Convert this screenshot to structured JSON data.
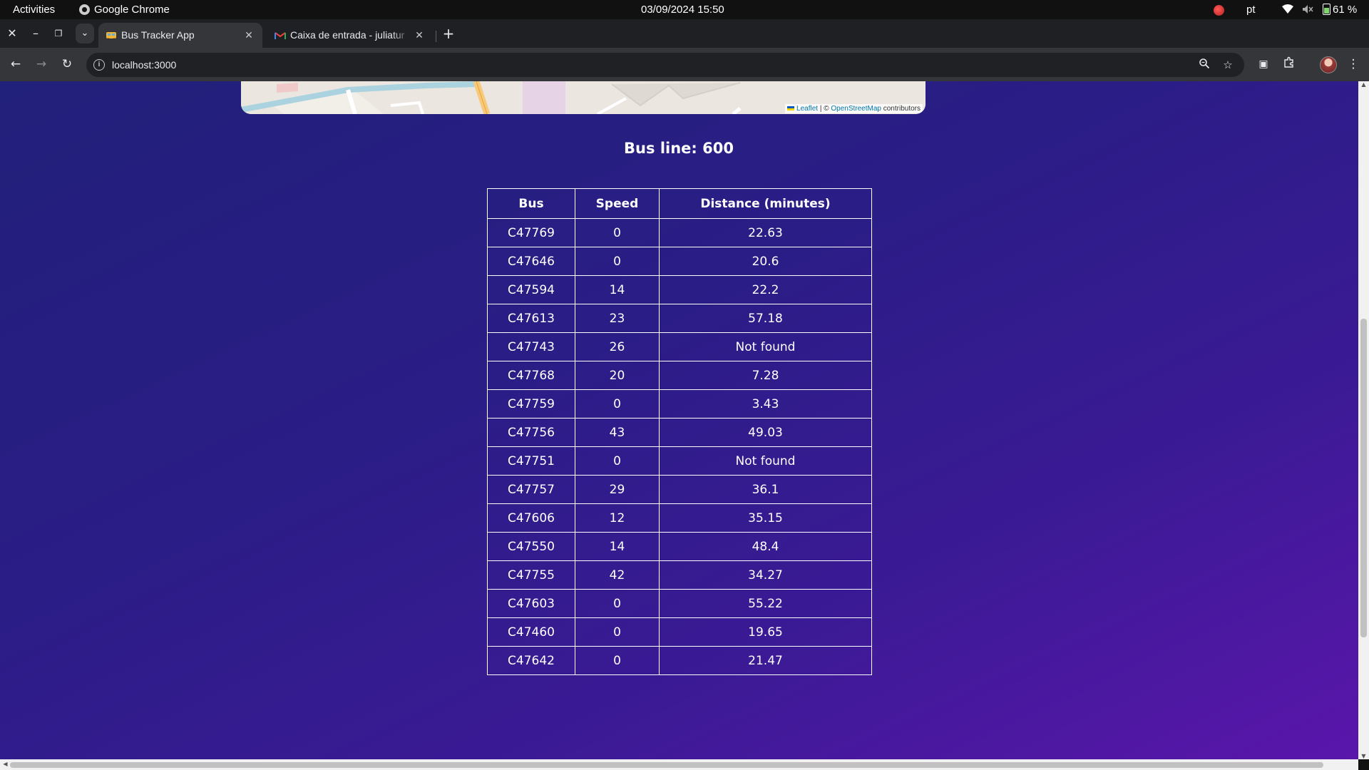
{
  "system_bar": {
    "activities": "Activities",
    "app_name": "Google Chrome",
    "datetime": "03/09/2024 15:50",
    "keyboard_layout": "pt",
    "battery": "61 %",
    "battery_level": 0.61
  },
  "browser": {
    "tabs": [
      {
        "title": "Bus Tracker App",
        "active": true,
        "favicon": "bus-icon"
      },
      {
        "title": "Caixa de entrada - juliatur",
        "active": false,
        "favicon": "gmail-icon"
      }
    ],
    "url": "localhost:3000"
  },
  "map": {
    "attribution_leaflet": "Leaflet",
    "attribution_sep": " | © ",
    "attribution_osm": "OpenStreetMap",
    "attribution_suffix": " contributors"
  },
  "bus_line": {
    "heading": "Bus line: 600"
  },
  "table": {
    "headers": [
      "Bus",
      "Speed",
      "Distance (minutes)"
    ],
    "rows": [
      [
        "C47769",
        "0",
        "22.63"
      ],
      [
        "C47646",
        "0",
        "20.6"
      ],
      [
        "C47594",
        "14",
        "22.2"
      ],
      [
        "C47613",
        "23",
        "57.18"
      ],
      [
        "C47743",
        "26",
        "Not found"
      ],
      [
        "C47768",
        "20",
        "7.28"
      ],
      [
        "C47759",
        "0",
        "3.43"
      ],
      [
        "C47756",
        "43",
        "49.03"
      ],
      [
        "C47751",
        "0",
        "Not found"
      ],
      [
        "C47757",
        "29",
        "36.1"
      ],
      [
        "C47606",
        "12",
        "35.15"
      ],
      [
        "C47550",
        "14",
        "48.4"
      ],
      [
        "C47755",
        "42",
        "34.27"
      ],
      [
        "C47603",
        "0",
        "55.22"
      ],
      [
        "C47460",
        "0",
        "19.65"
      ],
      [
        "C47642",
        "0",
        "21.47"
      ]
    ]
  },
  "colors": {
    "page_gradient_start": "#21207a",
    "page_gradient_end": "#5a16ab",
    "table_border": "#ffffff"
  }
}
